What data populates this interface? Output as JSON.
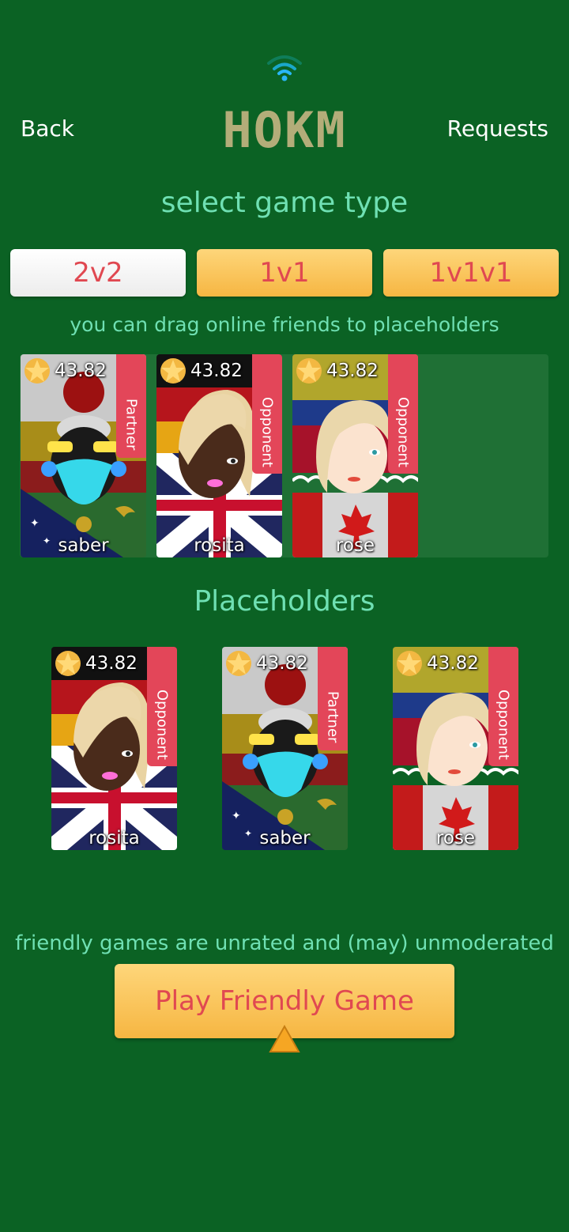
{
  "header": {
    "back_label": "Back",
    "title": "HOKM",
    "requests_label": "Requests",
    "wifi_icon": "wifi-icon"
  },
  "game_type": {
    "heading": "select game type",
    "tabs": [
      {
        "label": "2v2",
        "selected": true
      },
      {
        "label": "1v1",
        "selected": false
      },
      {
        "label": "1v1v1",
        "selected": false
      }
    ]
  },
  "friends": {
    "hint": "you can drag online friends to placeholders",
    "cards": [
      {
        "name": "saber",
        "rating": "43.82",
        "role": "Partner",
        "flag": "japan-australia"
      },
      {
        "name": "rosita",
        "rating": "43.82",
        "role": "Opponent",
        "flag": "germany-uk"
      },
      {
        "name": "rose",
        "rating": "43.82",
        "role": "Opponent",
        "flag": "colombia-canada"
      }
    ]
  },
  "placeholders": {
    "heading": "Placeholders",
    "cards": [
      {
        "name": "rosita",
        "rating": "43.82",
        "role": "Opponent",
        "flag": "germany-uk"
      },
      {
        "name": "saber",
        "rating": "43.82",
        "role": "Partner",
        "flag": "japan-australia"
      },
      {
        "name": "rose",
        "rating": "43.82",
        "role": "Opponent",
        "flag": "colombia-canada"
      }
    ]
  },
  "footer": {
    "note": "friendly games are unrated and (may) unmoderated",
    "play_label": "Play Friendly Game"
  },
  "colors": {
    "background": "#0b6224",
    "accent_text": "#6fe0b3",
    "button_text": "#e04851",
    "role_badge": "#e34659"
  }
}
